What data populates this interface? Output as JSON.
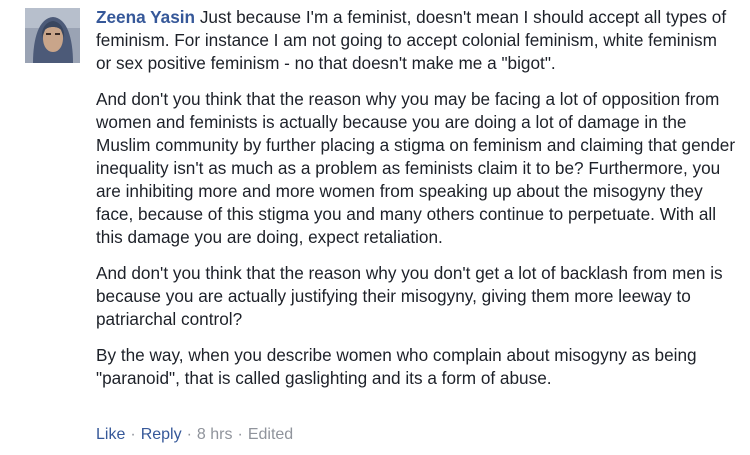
{
  "comment": {
    "author": "Zeena Yasin",
    "paragraphs": [
      "Just because I'm a feminist, doesn't mean I should accept all types of feminism. For instance I am not going to accept colonial feminism, white feminism or sex positive feminism - no that doesn't make me a \"bigot\".",
      "And don't you think that the reason why you may be facing a lot of opposition from women and feminists is actually because you are doing a lot of damage in the Muslim community by further placing a stigma on feminism and claiming that gender inequality isn't as much as a problem as feminists claim it to be? Furthermore, you are inhibiting more and more women from speaking up about the misogyny they face, because of this stigma you and many others continue to perpetuate. With all this damage you are doing, expect retaliation.",
      "And don't you think that the reason why you don't get a lot of backlash from men is because you are actually justifying their misogyny, giving them more leeway to patriarchal control?",
      "By the way, when you describe women who complain about misogyny as being \"paranoid\", that is called gaslighting and its a form of abuse."
    ],
    "actions": {
      "like": "Like",
      "reply": "Reply",
      "separator": "·",
      "time": "8 hrs",
      "edited": "Edited"
    },
    "colors": {
      "link": "#365899",
      "text": "#1d2129",
      "meta": "#90949c"
    }
  }
}
